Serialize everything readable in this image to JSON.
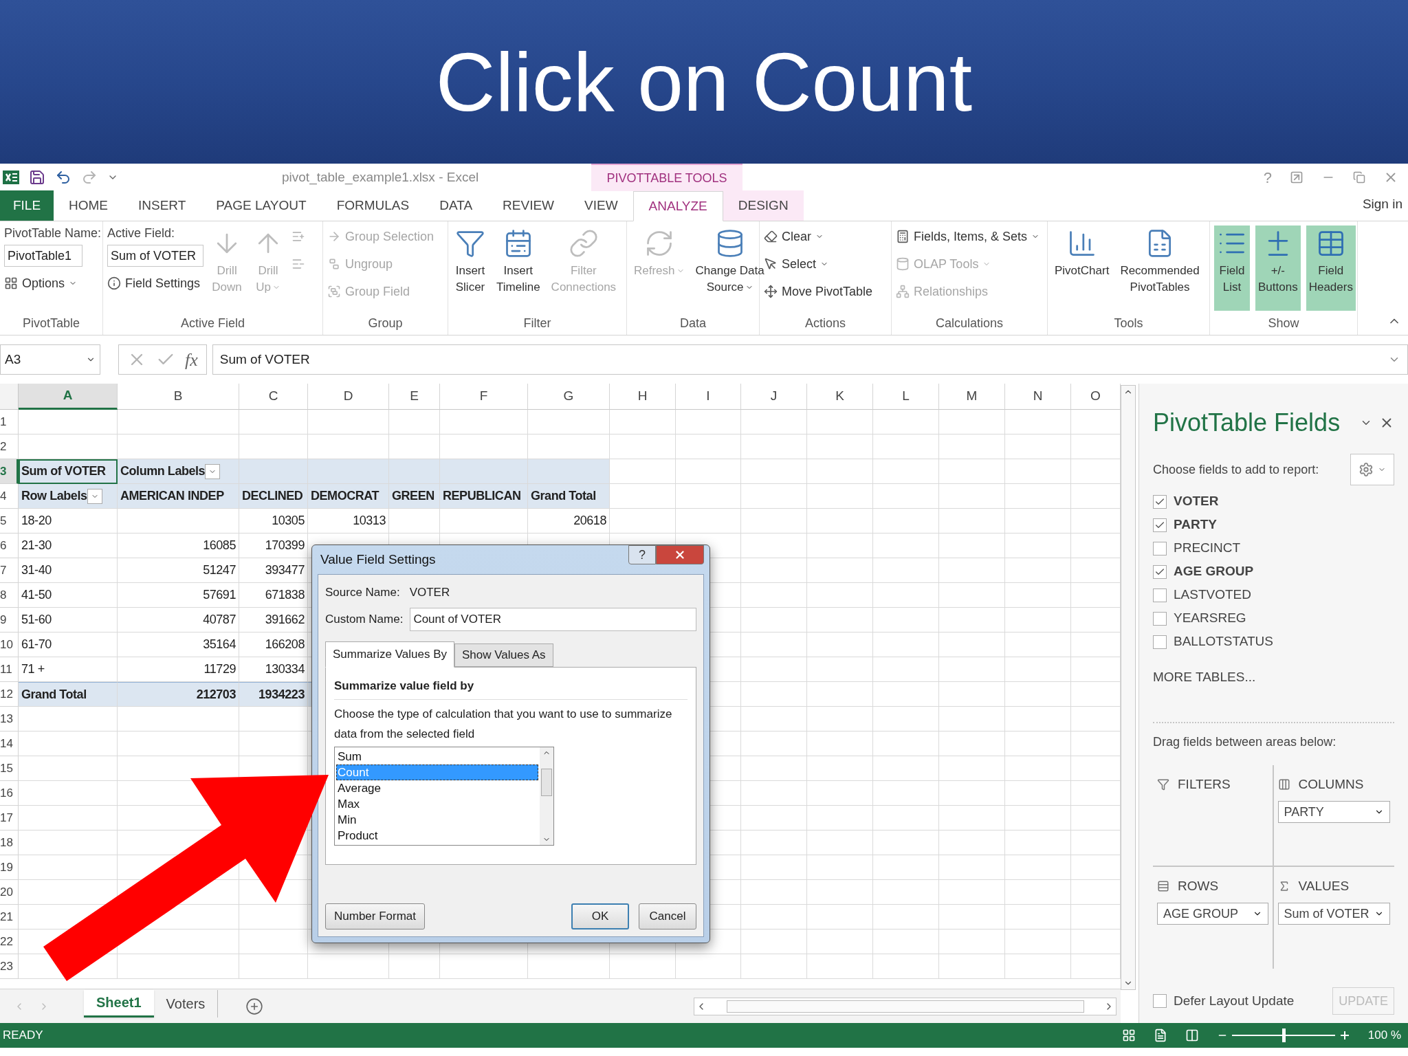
{
  "slide": {
    "title": "Click on Count"
  },
  "window": {
    "title": "pivot_table_example1.xlsx - Excel",
    "context_label": "PIVOTTABLE TOOLS",
    "help": "?",
    "sign_in": "Sign in"
  },
  "tabs": [
    {
      "label": "FILE",
      "kind": "file",
      "selected": false
    },
    {
      "label": "HOME",
      "kind": "normal",
      "selected": false
    },
    {
      "label": "INSERT",
      "kind": "normal",
      "selected": false
    },
    {
      "label": "PAGE LAYOUT",
      "kind": "normal",
      "selected": false
    },
    {
      "label": "FORMULAS",
      "kind": "normal",
      "selected": false
    },
    {
      "label": "DATA",
      "kind": "normal",
      "selected": false
    },
    {
      "label": "REVIEW",
      "kind": "normal",
      "selected": false
    },
    {
      "label": "VIEW",
      "kind": "normal",
      "selected": false
    },
    {
      "label": "ANALYZE",
      "kind": "context",
      "selected": true
    },
    {
      "label": "DESIGN",
      "kind": "context",
      "selected": false
    }
  ],
  "ribbon": {
    "groups": [
      {
        "label": "PivotTable",
        "columns": [
          [
            {
              "kind": "field",
              "label": "PivotTable Name:",
              "value": "PivotTable1"
            },
            {
              "kind": "small",
              "label": "Options",
              "disabled": false,
              "dropdown": true
            }
          ]
        ]
      },
      {
        "label": "Active Field",
        "columns": [
          [
            {
              "kind": "field",
              "label": "Active Field:",
              "value": "Sum of VOTER"
            },
            {
              "kind": "small",
              "label": "Field Settings",
              "disabled": false,
              "dropdown": false
            }
          ],
          [
            {
              "kind": "large",
              "lines": [
                "Drill",
                "Down"
              ],
              "disabled": true,
              "dropdown": false
            }
          ],
          [
            {
              "kind": "large",
              "lines": [
                "Drill",
                "Up"
              ],
              "disabled": true,
              "dropdown": true
            }
          ],
          [
            {
              "kind": "small",
              "disabled": true,
              "dropdown": false
            },
            {
              "kind": "small",
              "disabled": true,
              "dropdown": false
            }
          ]
        ]
      },
      {
        "label": "Group",
        "columns": [
          [
            {
              "kind": "small",
              "label": "Group Selection",
              "disabled": true,
              "dropdown": false
            },
            {
              "kind": "small",
              "label": "Ungroup",
              "disabled": true,
              "dropdown": false
            },
            {
              "kind": "small",
              "label": "Group Field",
              "disabled": true,
              "dropdown": false
            }
          ]
        ]
      },
      {
        "label": "Filter",
        "columns": [
          [
            {
              "kind": "large",
              "lines": [
                "Insert",
                "Slicer"
              ],
              "disabled": false,
              "dropdown": false
            }
          ],
          [
            {
              "kind": "large",
              "lines": [
                "Insert",
                "Timeline"
              ],
              "disabled": false,
              "dropdown": false
            }
          ],
          [
            {
              "kind": "large",
              "lines": [
                "Filter",
                "Connections"
              ],
              "disabled": true,
              "dropdown": false
            }
          ]
        ]
      },
      {
        "label": "Data",
        "columns": [
          [
            {
              "kind": "large",
              "lines": [
                "Refresh"
              ],
              "disabled": true,
              "dropdown": true
            }
          ],
          [
            {
              "kind": "large",
              "lines": [
                "Change Data",
                "Source"
              ],
              "disabled": false,
              "dropdown": true
            }
          ]
        ]
      },
      {
        "label": "Actions",
        "columns": [
          [
            {
              "kind": "small",
              "label": "Clear",
              "disabled": false,
              "dropdown": true
            },
            {
              "kind": "small",
              "label": "Select",
              "disabled": false,
              "dropdown": true
            },
            {
              "kind": "small",
              "label": "Move PivotTable",
              "disabled": false,
              "dropdown": false
            }
          ]
        ]
      },
      {
        "label": "Calculations",
        "columns": [
          [
            {
              "kind": "small",
              "label": "Fields, Items, & Sets",
              "disabled": false,
              "dropdown": true
            },
            {
              "kind": "small",
              "label": "OLAP Tools",
              "disabled": true,
              "dropdown": true
            },
            {
              "kind": "small",
              "label": "Relationships",
              "disabled": true,
              "dropdown": false
            }
          ]
        ]
      },
      {
        "label": "Tools",
        "columns": [
          [
            {
              "kind": "large",
              "lines": [
                "PivotChart"
              ],
              "disabled": false,
              "dropdown": false
            }
          ],
          [
            {
              "kind": "large",
              "lines": [
                "Recommended",
                "PivotTables"
              ],
              "disabled": false,
              "dropdown": false
            }
          ]
        ]
      },
      {
        "label": "Show",
        "columns": [
          [
            {
              "kind": "toggle",
              "lines": [
                "Field",
                "List"
              ],
              "on": true
            }
          ],
          [
            {
              "kind": "toggle",
              "lines": [
                "+/-",
                "Buttons"
              ],
              "on": true
            }
          ],
          [
            {
              "kind": "toggle",
              "lines": [
                "Field",
                "Headers"
              ],
              "on": true
            }
          ]
        ]
      }
    ]
  },
  "formula_bar": {
    "name_box": "A3",
    "function_label": "fx",
    "formula": "Sum of VOTER"
  },
  "sheet": {
    "columns": [
      {
        "label": "A",
        "selected": true
      },
      {
        "label": "B",
        "selected": false
      },
      {
        "label": "C",
        "selected": false
      },
      {
        "label": "D",
        "selected": false
      },
      {
        "label": "E",
        "selected": false
      },
      {
        "label": "F",
        "selected": false
      },
      {
        "label": "G",
        "selected": false
      },
      {
        "label": "H",
        "selected": false
      },
      {
        "label": "I",
        "selected": false
      },
      {
        "label": "J",
        "selected": false
      },
      {
        "label": "K",
        "selected": false
      },
      {
        "label": "L",
        "selected": false
      },
      {
        "label": "M",
        "selected": false
      },
      {
        "label": "N",
        "selected": false
      },
      {
        "label": "O",
        "selected": false
      }
    ],
    "rows": [
      {
        "number": "1",
        "selected": false,
        "kind": "empty"
      },
      {
        "number": "2",
        "selected": false,
        "kind": "empty"
      },
      {
        "number": "3",
        "selected": true,
        "kind": "title",
        "cells": [
          "Sum of VOTER",
          "Column Labels"
        ]
      },
      {
        "number": "4",
        "selected": false,
        "kind": "header",
        "cells": [
          "Row Labels",
          "AMERICAN INDEP",
          "DECLINED",
          "DEMOCRAT",
          "GREEN",
          "REPUBLICAN",
          "Grand Total"
        ]
      },
      {
        "number": "5",
        "selected": false,
        "kind": "data",
        "cells": [
          "18-20",
          null,
          "10305",
          "10313",
          null,
          null,
          "20618"
        ]
      },
      {
        "number": "6",
        "selected": false,
        "kind": "data",
        "cells": [
          "21-30",
          "16085",
          "170399"
        ]
      },
      {
        "number": "7",
        "selected": false,
        "kind": "data",
        "cells": [
          "31-40",
          "51247",
          "393477"
        ]
      },
      {
        "number": "8",
        "selected": false,
        "kind": "data",
        "cells": [
          "41-50",
          "57691",
          "671838"
        ]
      },
      {
        "number": "9",
        "selected": false,
        "kind": "data",
        "cells": [
          "51-60",
          "40787",
          "391662"
        ]
      },
      {
        "number": "10",
        "selected": false,
        "kind": "data",
        "cells": [
          "61-70",
          "35164",
          "166208"
        ]
      },
      {
        "number": "11",
        "selected": false,
        "kind": "data",
        "cells": [
          "71 +",
          "11729",
          "130334"
        ]
      },
      {
        "number": "12",
        "selected": false,
        "kind": "total",
        "cells": [
          "Grand Total",
          "212703",
          "1934223"
        ]
      },
      {
        "number": "13",
        "selected": false,
        "kind": "empty"
      },
      {
        "number": "14",
        "selected": false,
        "kind": "empty"
      },
      {
        "number": "15",
        "selected": false,
        "kind": "empty"
      },
      {
        "number": "16",
        "selected": false,
        "kind": "empty"
      },
      {
        "number": "17",
        "selected": false,
        "kind": "empty"
      },
      {
        "number": "18",
        "selected": false,
        "kind": "empty"
      },
      {
        "number": "19",
        "selected": false,
        "kind": "empty"
      },
      {
        "number": "20",
        "selected": false,
        "kind": "empty"
      },
      {
        "number": "21",
        "selected": false,
        "kind": "empty"
      },
      {
        "number": "22",
        "selected": false,
        "kind": "empty"
      },
      {
        "number": "23",
        "selected": false,
        "kind": "empty"
      }
    ]
  },
  "dialog": {
    "title": "Value Field Settings",
    "help": "?",
    "source_label": "Source Name:",
    "source_value": "VOTER",
    "custom_label": "Custom Name:",
    "custom_value": "Count of VOTER",
    "tabs": [
      {
        "label": "Summarize Values By",
        "selected": true
      },
      {
        "label": "Show Values As",
        "selected": false
      }
    ],
    "section_heading": "Summarize value field by",
    "description": "Choose the type of calculation that you want to use to summarize data from the selected field",
    "options": [
      {
        "label": "Sum",
        "selected": false
      },
      {
        "label": "Count",
        "selected": true
      },
      {
        "label": "Average",
        "selected": false
      },
      {
        "label": "Max",
        "selected": false
      },
      {
        "label": "Min",
        "selected": false
      },
      {
        "label": "Product",
        "selected": false
      }
    ],
    "buttons": [
      {
        "label": "Number Format",
        "kind": "secondary"
      },
      {
        "label": "OK",
        "kind": "default"
      },
      {
        "label": "Cancel",
        "kind": "normal"
      }
    ]
  },
  "field_pane": {
    "title": "PivotTable Fields",
    "prompt": "Choose fields to add to report:",
    "fields": [
      {
        "label": "VOTER",
        "checked": true
      },
      {
        "label": "PARTY",
        "checked": true
      },
      {
        "label": "PRECINCT",
        "checked": false
      },
      {
        "label": "AGE GROUP",
        "checked": true
      },
      {
        "label": "LASTVOTED",
        "checked": false
      },
      {
        "label": "YEARSREG",
        "checked": false
      },
      {
        "label": "BALLOTSTATUS",
        "checked": false
      }
    ],
    "more_tables": "MORE TABLES...",
    "drag_hint": "Drag fields between areas below:",
    "areas": [
      {
        "label": "FILTERS",
        "kind": "filters"
      },
      {
        "label": "COLUMNS",
        "kind": "columns",
        "items": [
          "PARTY"
        ]
      },
      {
        "label": "ROWS",
        "kind": "rows",
        "items": [
          "AGE GROUP"
        ]
      },
      {
        "label": "VALUES",
        "kind": "values",
        "items": [
          "Sum of VOTER"
        ]
      }
    ],
    "defer": {
      "label": "Defer Layout Update",
      "checked": false
    },
    "update_button": {
      "label": "UPDATE",
      "disabled": true
    }
  },
  "sheet_tabs": [
    {
      "label": "Sheet1",
      "selected": true
    },
    {
      "label": "Voters",
      "selected": false
    }
  ],
  "status_bar": {
    "status": "READY",
    "zoom": "100 %",
    "zoom_slider": {
      "level": 0.5
    }
  }
}
